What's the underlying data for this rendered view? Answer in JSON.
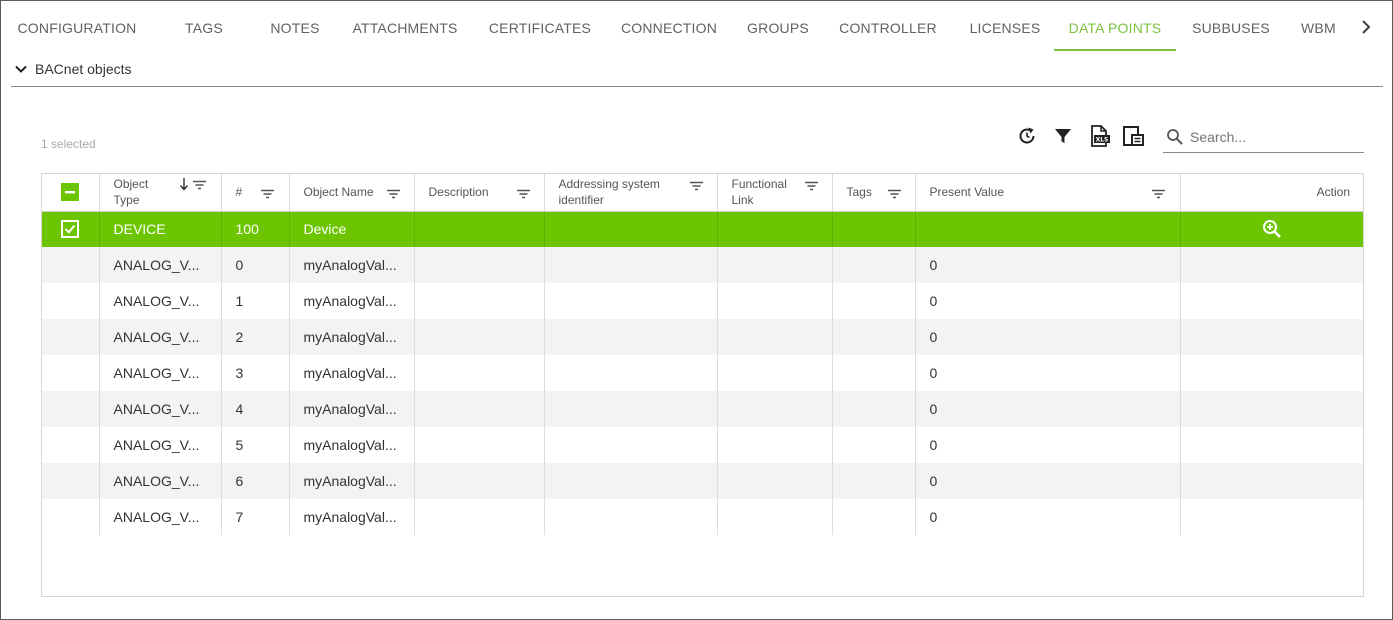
{
  "tabs": [
    {
      "label": "CONFIGURATION"
    },
    {
      "label": "TAGS"
    },
    {
      "label": "NOTES"
    },
    {
      "label": "ATTACHMENTS"
    },
    {
      "label": "CERTIFICATES"
    },
    {
      "label": "CONNECTION"
    },
    {
      "label": "GROUPS"
    },
    {
      "label": "CONTROLLER"
    },
    {
      "label": "LICENSES"
    },
    {
      "label": "DATA POINTS"
    },
    {
      "label": "SUBBUSES"
    },
    {
      "label": "WBM"
    }
  ],
  "active_tab": "DATA POINTS",
  "section": {
    "title": "BACnet objects",
    "expanded_icon": "chevron-down-icon"
  },
  "toolbar": {
    "selected_count": "1 selected",
    "icons": [
      "refresh-icon",
      "filter-icon",
      "export-xlsx-icon",
      "column-chooser-icon"
    ],
    "search_placeholder": "Search..."
  },
  "table": {
    "headers": {
      "object_type": "Object Type",
      "number": "#",
      "object_name": "Object Name",
      "description": "Description",
      "addressing_system_identifier": "Addressing system identifier",
      "functional_link": "Functional Link",
      "tags": "Tags",
      "present_value": "Present Value",
      "action": "Action"
    },
    "sort": {
      "column": "object_type",
      "direction": "descending"
    },
    "rows": [
      {
        "selected": true,
        "object_type": "DEVICE",
        "number": "100",
        "object_name": "Device",
        "description": "",
        "addressing": "",
        "functional_link": "",
        "tags": "",
        "present_value": "",
        "action_icon": "zoom-in-icon"
      },
      {
        "selected": false,
        "object_type": "ANALOG_V...",
        "number": "0",
        "object_name": "myAnalogVal...",
        "description": "",
        "addressing": "",
        "functional_link": "",
        "tags": "",
        "present_value": "0"
      },
      {
        "selected": false,
        "object_type": "ANALOG_V...",
        "number": "1",
        "object_name": "myAnalogVal...",
        "description": "",
        "addressing": "",
        "functional_link": "",
        "tags": "",
        "present_value": "0"
      },
      {
        "selected": false,
        "object_type": "ANALOG_V...",
        "number": "2",
        "object_name": "myAnalogVal...",
        "description": "",
        "addressing": "",
        "functional_link": "",
        "tags": "",
        "present_value": "0"
      },
      {
        "selected": false,
        "object_type": "ANALOG_V...",
        "number": "3",
        "object_name": "myAnalogVal...",
        "description": "",
        "addressing": "",
        "functional_link": "",
        "tags": "",
        "present_value": "0"
      },
      {
        "selected": false,
        "object_type": "ANALOG_V...",
        "number": "4",
        "object_name": "myAnalogVal...",
        "description": "",
        "addressing": "",
        "functional_link": "",
        "tags": "",
        "present_value": "0"
      },
      {
        "selected": false,
        "object_type": "ANALOG_V...",
        "number": "5",
        "object_name": "myAnalogVal...",
        "description": "",
        "addressing": "",
        "functional_link": "",
        "tags": "",
        "present_value": "0"
      },
      {
        "selected": false,
        "object_type": "ANALOG_V...",
        "number": "6",
        "object_name": "myAnalogVal...",
        "description": "",
        "addressing": "",
        "functional_link": "",
        "tags": "",
        "present_value": "0"
      },
      {
        "selected": false,
        "object_type": "ANALOG_V...",
        "number": "7",
        "object_name": "myAnalogVal...",
        "description": "",
        "addressing": "",
        "functional_link": "",
        "tags": "",
        "present_value": "0"
      }
    ]
  },
  "colors": {
    "accent": "#7dc242",
    "selected_row": "#6cc500",
    "alt_row": "#f3f3f3"
  }
}
